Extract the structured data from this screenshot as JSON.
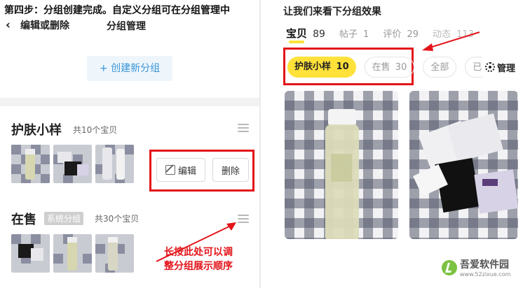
{
  "left": {
    "step_title": "第四步：分组创建完成。自定义分组可在分组管理中",
    "nav_back": "编辑或删除",
    "nav_title": "分组管理",
    "create_button": "+ 创建新分组",
    "groups": [
      {
        "name": "护肤小样",
        "count": "共10个宝贝"
      },
      {
        "name": "在售",
        "tag": "系统分组",
        "count": "共30个宝贝"
      }
    ],
    "edit_button": "编辑",
    "delete_button": "删除",
    "annotation_line1": "长按此处可以调",
    "annotation_line2": "整分组展示顺序"
  },
  "right": {
    "title": "让我们来看下分组效果",
    "tabs": [
      {
        "label": "宝贝",
        "count": "89"
      },
      {
        "label": "帖子",
        "count": "1"
      },
      {
        "label": "评价",
        "count": "29"
      },
      {
        "label": "动态",
        "count": "113"
      }
    ],
    "pills": [
      {
        "label": "护肤小样",
        "count": "10"
      },
      {
        "label": "在售",
        "count": "30"
      },
      {
        "label": "全部"
      },
      {
        "label": "已"
      }
    ],
    "manage_label": "管理"
  },
  "watermark": {
    "brand": "吾爱软件园",
    "site": "www.52zixue.com"
  },
  "colors": {
    "accent_yellow": "#ffe13a",
    "annotation_red": "#e3141a",
    "link_blue": "#3a95d8"
  }
}
